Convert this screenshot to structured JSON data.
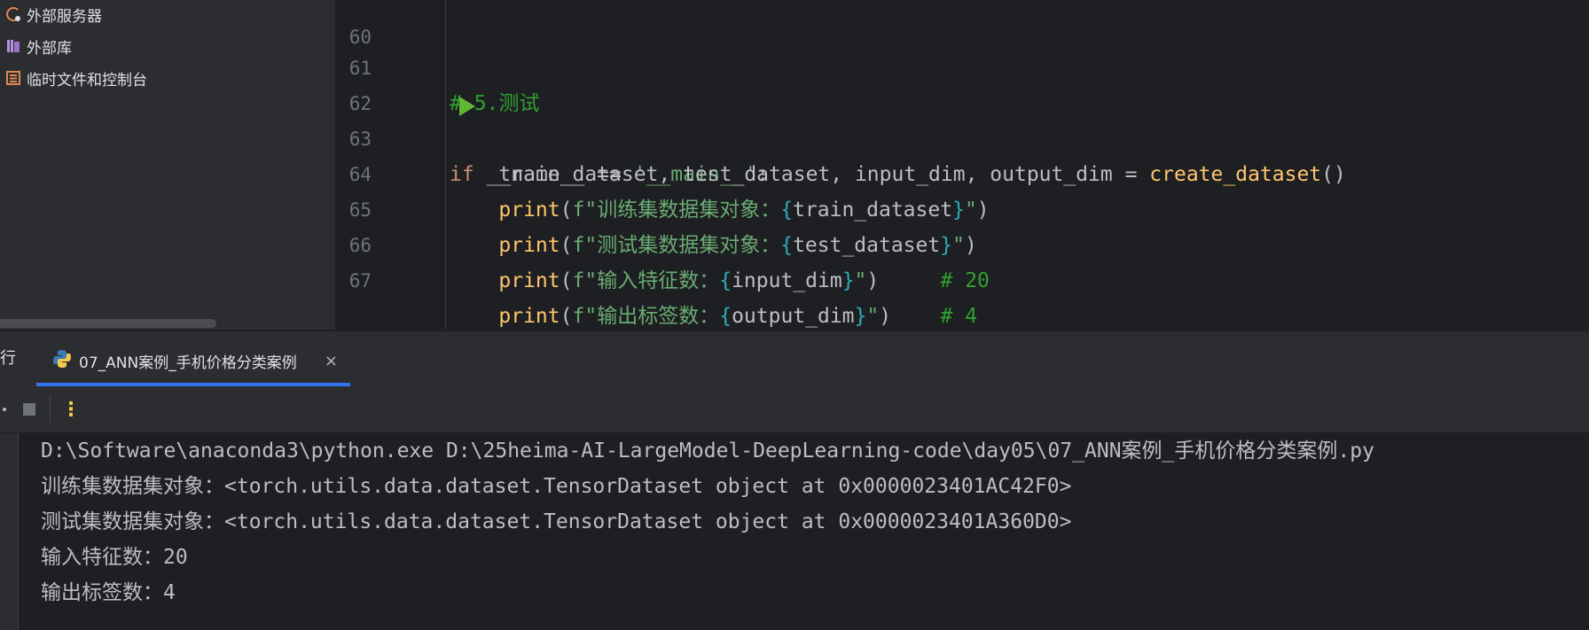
{
  "project_tree": {
    "items": [
      {
        "label": "外部服务器",
        "icon": "external-server-icon"
      },
      {
        "label": "外部库",
        "icon": "library-icon"
      },
      {
        "label": "临时文件和控制台",
        "icon": "scratch-file-icon"
      }
    ]
  },
  "editor": {
    "line_numbers": [
      "60",
      "61",
      "62",
      "63",
      "64",
      "65",
      "66",
      "67"
    ],
    "lines": {
      "l61": {
        "comment": "# 5.测试"
      },
      "l62": {
        "kw": "if",
        "rest_a": " __name__ == ",
        "str": "'__main__'",
        "rest_b": ":"
      },
      "l63": {
        "lhs": "    train_dataset, test_dataset, input_dim, output_dim = ",
        "fn": "create_dataset",
        "tail": "()"
      },
      "l64": {
        "indent": "    ",
        "fn": "print",
        "open": "(",
        "fpre": "f\"训练集数据集对象：",
        "lb": "{",
        "var": "train_dataset",
        "rb": "}",
        "fpost": "\"",
        "close": ")"
      },
      "l65": {
        "indent": "    ",
        "fn": "print",
        "open": "(",
        "fpre": "f\"测试集数据集对象：",
        "lb": "{",
        "var": "test_dataset",
        "rb": "}",
        "fpost": "\"",
        "close": ")"
      },
      "l66": {
        "indent": "    ",
        "fn": "print",
        "open": "(",
        "fpre": "f\"输入特征数：",
        "lb": "{",
        "var": "input_dim",
        "rb": "}",
        "fpost": "\"",
        "close": ")",
        "gap": "     ",
        "comment": "# 20"
      },
      "l67": {
        "indent": "    ",
        "fn": "print",
        "open": "(",
        "fpre": "f\"输出标签数：",
        "lb": "{",
        "var": "output_dim",
        "rb": "}",
        "fpost": "\"",
        "close": ")",
        "gap": "    ",
        "comment": "# 4"
      }
    }
  },
  "run_window": {
    "label": "行",
    "tab_label": "07_ANN案例_手机价格分类案例",
    "close_glyph": "×",
    "more_glyph": "⋮"
  },
  "console": {
    "lines": [
      "D:\\Software\\anaconda3\\python.exe D:\\25heima-AI-LargeModel-DeepLearning-code\\day05\\07_ANN案例_手机价格分类案例.py",
      "训练集数据集对象：<torch.utils.data.dataset.TensorDataset object at 0x0000023401AC42F0>",
      "测试集数据集对象：<torch.utils.data.dataset.TensorDataset object at 0x0000023401A360D0>",
      "输入特征数：20",
      "输出标签数：4"
    ]
  },
  "colors": {
    "keyword": "#cf8e6d",
    "comment": "#2fa02f",
    "function": "#ffc66d",
    "string": "#6aab73",
    "brace": "#2aacb8",
    "tab_accent": "#3574f0",
    "run_green": "#5fb832"
  }
}
